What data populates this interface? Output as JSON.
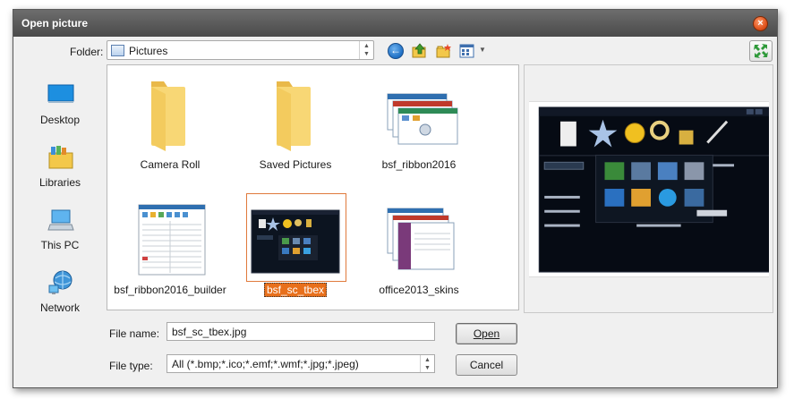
{
  "dialog": {
    "title": "Open picture",
    "close_symbol": "×"
  },
  "folder": {
    "label": "Folder:",
    "current": "Pictures"
  },
  "places": [
    {
      "label": "Desktop",
      "icon": "desktop-icon"
    },
    {
      "label": "Libraries",
      "icon": "libraries-icon"
    },
    {
      "label": "This PC",
      "icon": "computer-icon"
    },
    {
      "label": "Network",
      "icon": "network-icon"
    }
  ],
  "files": [
    {
      "name": "Camera Roll",
      "kind": "folder"
    },
    {
      "name": "Saved Pictures",
      "kind": "folder"
    },
    {
      "name": "bsf_ribbon2016",
      "kind": "image"
    },
    {
      "name": "bsf_ribbon2016_builder",
      "kind": "image"
    },
    {
      "name": "bsf_sc_tbex",
      "kind": "image",
      "selected": true
    },
    {
      "name": "office2013_skins",
      "kind": "image"
    }
  ],
  "form": {
    "filename_label": "File name:",
    "filename_value": "bsf_sc_tbex.jpg",
    "filetype_label": "File type:",
    "filetype_value": "All (*.bmp;*.ico;*.emf;*.wmf;*.jpg;*.jpeg)",
    "open_label": "Open",
    "cancel_label": "Cancel"
  },
  "colors": {
    "titlebar": "#5a5a5a",
    "selection": "#e8701c",
    "folder_yellow": "#f8d775"
  }
}
